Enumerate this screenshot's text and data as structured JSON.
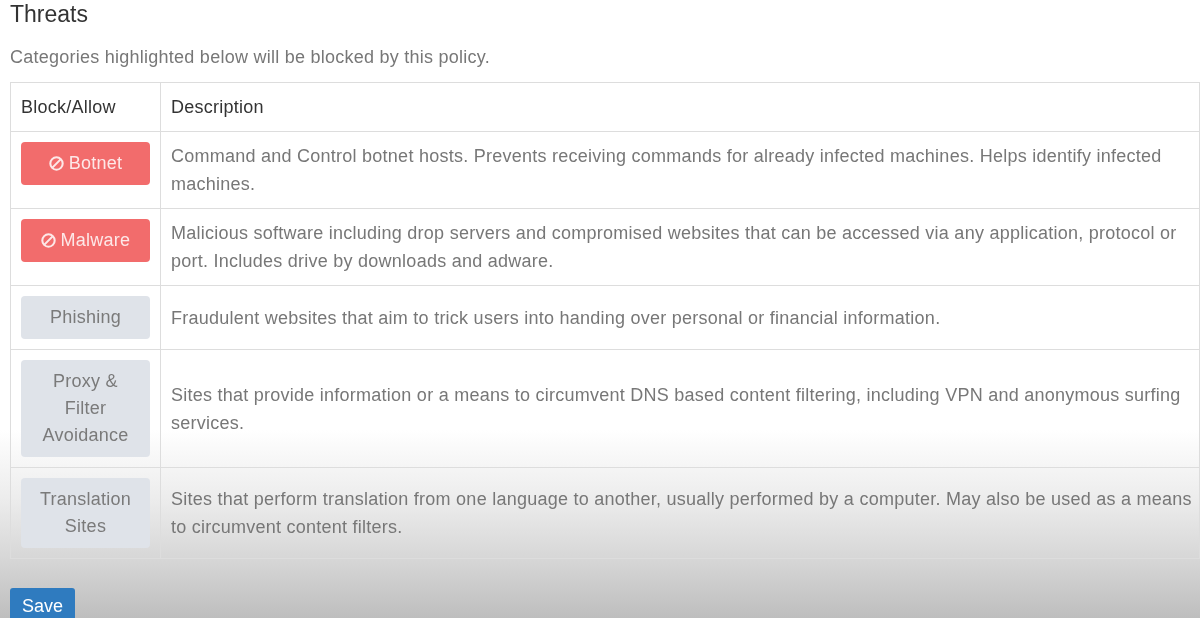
{
  "title": "Threats",
  "subtitle": "Categories highlighted below will be blocked by this policy.",
  "table": {
    "columns": [
      "Block/Allow",
      "Description"
    ],
    "rows": [
      {
        "category": "Botnet",
        "blocked": true,
        "description": "Command and Control botnet hosts. Prevents receiving commands for already infected machines. Helps identify infected machines."
      },
      {
        "category": "Malware",
        "blocked": true,
        "description": "Malicious software including drop servers and compromised websites that can be accessed via any application, protocol or port. Includes drive by downloads and adware."
      },
      {
        "category": "Phishing",
        "blocked": false,
        "description": "Fraudulent websites that aim to trick users into handing over personal or financial information."
      },
      {
        "category": "Proxy & Filter Avoidance",
        "blocked": false,
        "description": "Sites that provide information or a means to circumvent DNS based content filtering, including VPN and anonymous surfing services."
      },
      {
        "category": "Translation Sites",
        "blocked": false,
        "description": "Sites that perform translation from one language to another, usually performed by a computer. May also be used as a means to circumvent content filters."
      }
    ]
  },
  "save_button": {
    "label": "Save"
  }
}
